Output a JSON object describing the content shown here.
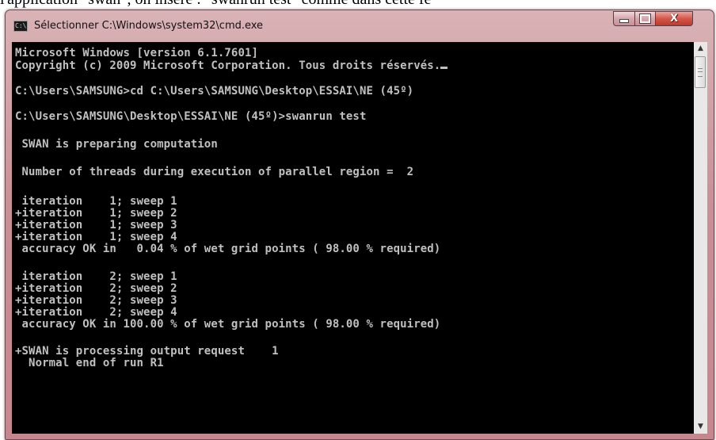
{
  "document": {
    "partial_text": "l'application \"swan\", on insère : \"swanrun test\" comme dans cette fe"
  },
  "window": {
    "title": "Sélectionner C:\\Windows\\system32\\cmd.exe",
    "icon": "cmd-icon",
    "controls": {
      "minimize_icon": "minimize-icon",
      "maximize_icon": "maximize-icon",
      "close_glyph": "X"
    }
  },
  "console": {
    "lines": [
      "Microsoft Windows [version 6.1.7601]",
      "Copyright (c) 2009 Microsoft Corporation. Tous droits réservés.",
      "C:\\Users\\SAMSUNG>cd C:\\Users\\SAMSUNG\\Desktop\\ESSAI\\NE (45º)",
      "C:\\Users\\SAMSUNG\\Desktop\\ESSAI\\NE (45º)>swanrun test",
      " SWAN is preparing computation",
      " Number of threads during execution of parallel region =  2",
      " iteration    1; sweep 1",
      "+iteration    1; sweep 2",
      "+iteration    1; sweep 3",
      "+iteration    1; sweep 4",
      " accuracy OK in   0.04 % of wet grid points ( 98.00 % required)",
      " iteration    2; sweep 1",
      "+iteration    2; sweep 2",
      "+iteration    2; sweep 3",
      "+iteration    2; sweep 4",
      " accuracy OK in 100.00 % of wet grid points ( 98.00 % required)",
      "+SWAN is processing output request    1",
      "  Normal end of run R1"
    ]
  },
  "scrollbar": {
    "up_arrow": "▲",
    "down_arrow": "▼"
  },
  "colors": {
    "console_bg": "#000000",
    "console_text": "#c0c0c0",
    "frame": "#c98f96",
    "close_button": "#c0392b"
  }
}
